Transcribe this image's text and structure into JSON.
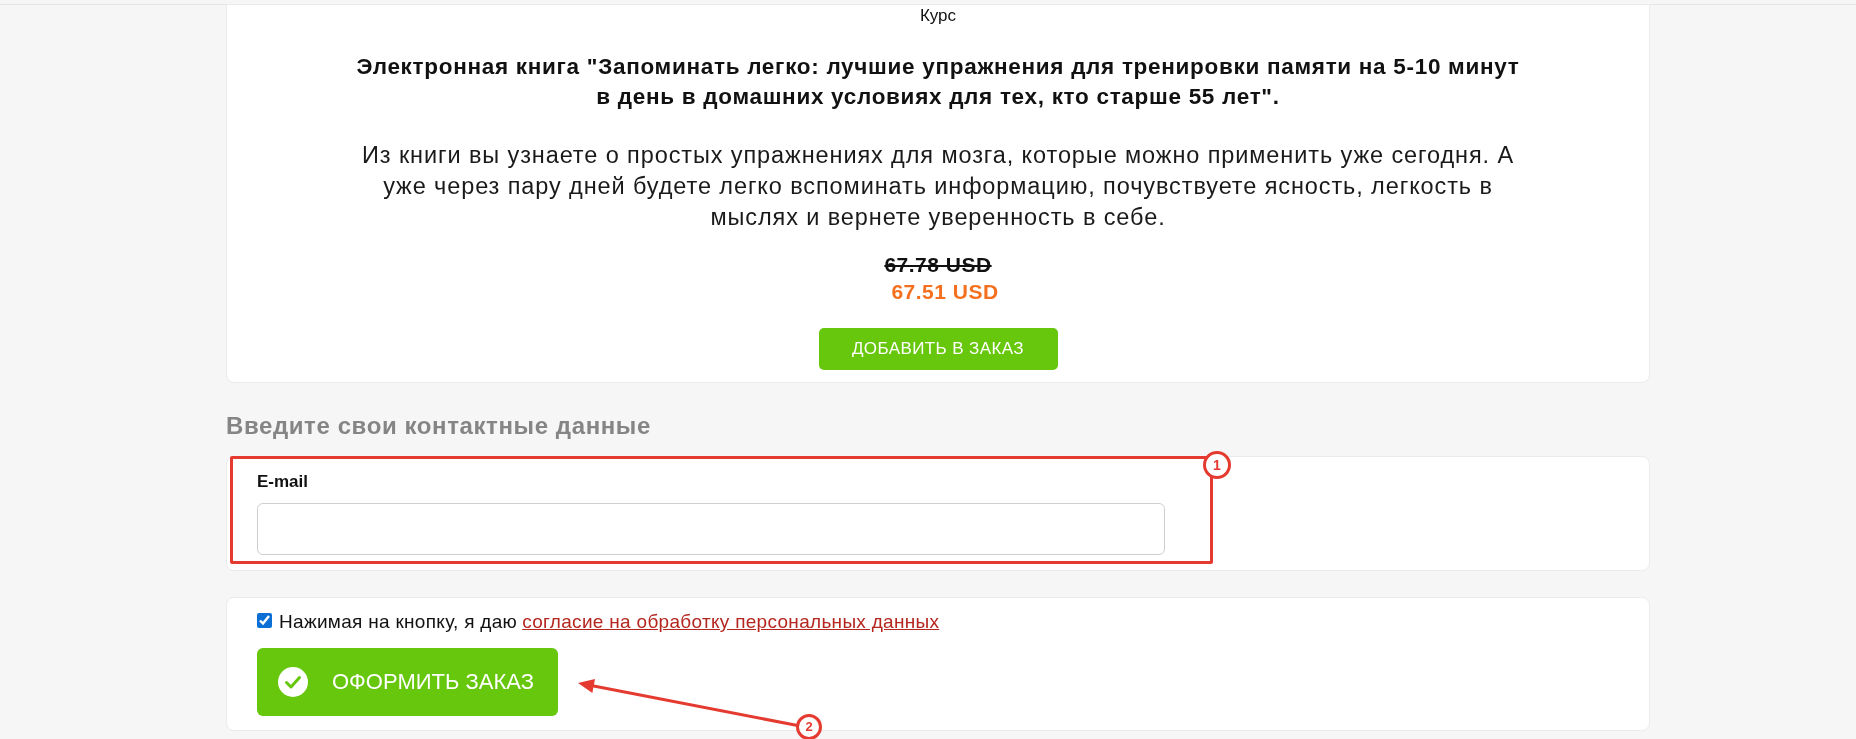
{
  "product": {
    "category": "Курс",
    "title": "Электронная книга \"Запоминать легко: лучшие упражнения для тренировки памяти на 5-10 минут в день в домашних условиях для тех, кто старше 55 лет\".",
    "description": "Из книги вы узнаете о простых упражнениях для мозга, которые можно применить уже сегодня. А уже через пару дней будете легко вспоминать информацию, почувствуете ясность, легкость в мыслях и вернете уверенность в себе.",
    "old_price": "67.78 USD",
    "price": "67.51 USD",
    "add_button": "ДОБАВИТЬ В ЗАКАЗ"
  },
  "contact": {
    "heading": "Введите свои контактные данные",
    "fields": [
      {
        "label": "E-mail"
      }
    ]
  },
  "consent": {
    "checked": true,
    "text": "Нажимая на кнопку, я даю",
    "link": "согласие на обработку персональных данных"
  },
  "submit_button": "ОФОРМИТЬ ЗАКАЗ",
  "annotations": [
    {
      "kind": "frame",
      "number": "1"
    },
    {
      "kind": "arrow",
      "number": "2"
    }
  ]
}
